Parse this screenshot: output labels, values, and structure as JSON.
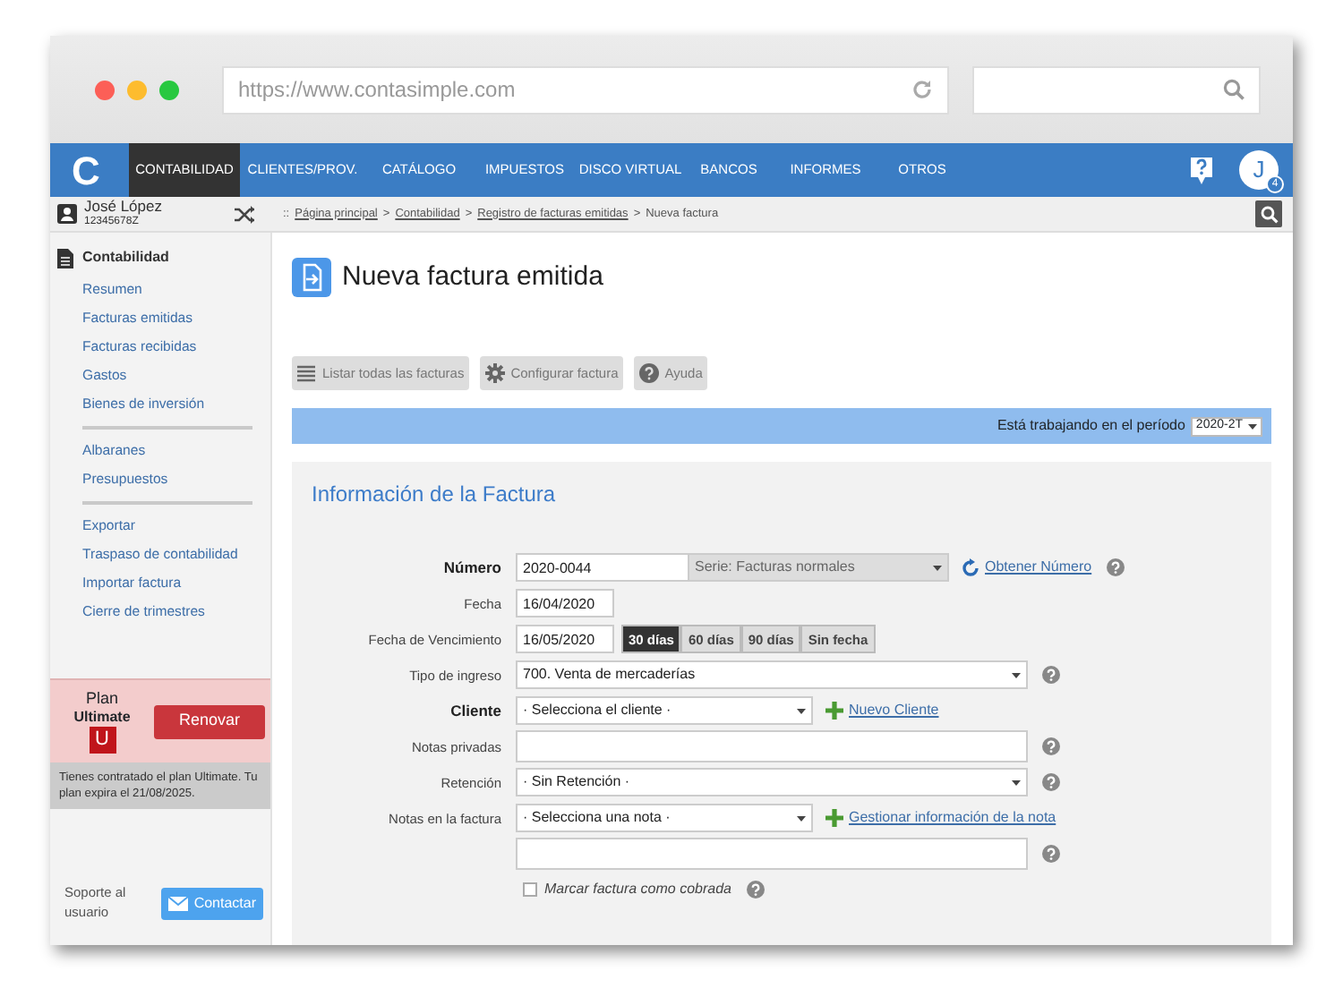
{
  "browser": {
    "url": "https://www.contasimple.com"
  },
  "navbar": {
    "logo": "C",
    "items": [
      {
        "label": "CONTABILIDAD",
        "selected": true
      },
      {
        "label": "CLIENTES/PROV.",
        "selected": false
      },
      {
        "label": "CATÁLOGO",
        "selected": false
      },
      {
        "label": "IMPUESTOS",
        "selected": false
      },
      {
        "label": "DISCO VIRTUAL",
        "selected": false
      },
      {
        "label": "BANCOS",
        "selected": false
      },
      {
        "label": "INFORMES",
        "selected": false
      },
      {
        "label": "OTROS",
        "selected": false
      }
    ],
    "avatar": "J",
    "badge": "4"
  },
  "user": {
    "name": "José López",
    "id": "12345678Z"
  },
  "breadcrumb": [
    {
      "text": "::",
      "kind": "sep"
    },
    {
      "text": "Página principal",
      "kind": "link"
    },
    {
      "text": ">",
      "kind": "sep"
    },
    {
      "text": "Contabilidad",
      "kind": "link"
    },
    {
      "text": ">",
      "kind": "sep"
    },
    {
      "text": "Registro de facturas emitidas",
      "kind": "link"
    },
    {
      "text": ">",
      "kind": "sep"
    },
    {
      "text": "Nueva factura",
      "kind": "current"
    }
  ],
  "sidebar": {
    "section": "Contabilidad",
    "groups": [
      [
        "Resumen",
        "Facturas emitidas",
        "Facturas recibidas",
        "Gastos",
        "Bienes de inversión"
      ],
      [
        "Albaranes",
        "Presupuestos"
      ],
      [
        "Exportar",
        "Traspaso de contabilidad",
        "Importar factura",
        "Cierre de trimestres"
      ]
    ],
    "plan": {
      "label": "Plan",
      "name": "Ultimate",
      "letter": "U",
      "button": "Renovar",
      "note": "Tienes contratado el plan Ultimate. Tu plan expira el 21/08/2025."
    },
    "support": {
      "text": "Soporte al usuario",
      "button": "Contactar"
    }
  },
  "main": {
    "title": "Nueva factura emitida",
    "toolbar": [
      {
        "label": "Listar todas las facturas"
      },
      {
        "label": "Configurar factura"
      },
      {
        "label": "Ayuda"
      }
    ],
    "period": {
      "label": "Está trabajando en el período",
      "value": "2020-2T"
    },
    "panel": {
      "title": "Información de la Factura",
      "fields": [
        {
          "label": "Número",
          "bold": true,
          "controls": [
            {
              "kind": "code-input",
              "value": "2020-0044"
            },
            {
              "kind": "series-select",
              "value": "Serie: Facturas normales",
              "disabled": true
            },
            {
              "kind": "refresh-link",
              "text": "Obtener Número"
            },
            {
              "kind": "help"
            }
          ]
        },
        {
          "label": "Fecha",
          "bold": false,
          "controls": [
            {
              "kind": "date-input",
              "value": "16/04/2020"
            }
          ]
        },
        {
          "label": "Fecha de Vencimiento",
          "bold": false,
          "controls": [
            {
              "kind": "date-input",
              "value": "16/05/2020"
            },
            {
              "kind": "segments",
              "options": [
                {
                  "label": "30 días",
                  "selected": true
                },
                {
                  "label": "60 días",
                  "selected": false
                },
                {
                  "label": "90 días",
                  "selected": false
                },
                {
                  "label": "Sin fecha",
                  "selected": false
                }
              ]
            }
          ]
        },
        {
          "label": "Tipo de ingreso",
          "bold": false,
          "controls": [
            {
              "kind": "select",
              "value": "700. Venta de mercaderías"
            },
            {
              "kind": "help"
            }
          ]
        },
        {
          "label": "Cliente",
          "bold": true,
          "controls": [
            {
              "kind": "compact-select",
              "value": "· Selecciona el cliente ·"
            },
            {
              "kind": "add-link",
              "text": "Nuevo Cliente"
            }
          ]
        },
        {
          "label": "Notas privadas",
          "bold": false,
          "controls": [
            {
              "kind": "textarea"
            },
            {
              "kind": "help"
            }
          ]
        },
        {
          "label": "Retención",
          "bold": false,
          "controls": [
            {
              "kind": "select",
              "value": "· Sin Retención ·"
            },
            {
              "kind": "help"
            }
          ]
        },
        {
          "label": "Notas en la factura",
          "bold": false,
          "controls": [
            {
              "kind": "compact-select",
              "value": "· Selecciona una nota ·"
            },
            {
              "kind": "add-link",
              "text": "Gestionar información de la nota"
            }
          ]
        },
        {
          "controls": [
            {
              "kind": "textarea"
            },
            {
              "kind": "help"
            }
          ]
        },
        {
          "controls": [
            {
              "kind": "checkbox",
              "text": "Marcar factura como cobrada",
              "checked": false
            },
            {
              "kind": "help"
            }
          ]
        }
      ]
    }
  }
}
